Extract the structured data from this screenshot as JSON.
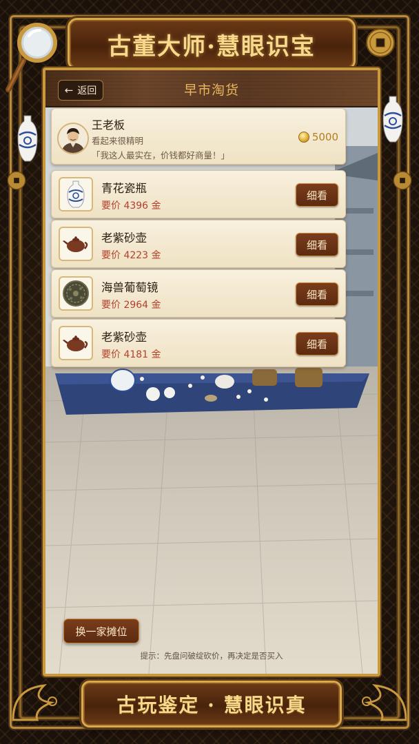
{
  "game": {
    "title": "古董大师·慧眼识宝",
    "footer_slogan": "古玩鉴定 · 慧眼识真"
  },
  "header": {
    "back_label": "返回",
    "back_icon": "left-arrow-icon",
    "title": "早市淘货"
  },
  "merchant": {
    "name": "王老板",
    "description": "看起来很精明",
    "quote": "「我这人最实在，价钱都好商量！」",
    "gold": "5000",
    "gold_icon": "gold-coin-icon"
  },
  "items": [
    {
      "name": "青花瓷瓶",
      "price": "要价 4396 金",
      "button": "细看",
      "icon": "blue-white-vase-icon"
    },
    {
      "name": "老紫砂壶",
      "price": "要价 4223 金",
      "button": "细看",
      "icon": "teapot-icon"
    },
    {
      "name": "海兽葡萄镜",
      "price": "要价 2964 金",
      "button": "细看",
      "icon": "bronze-mirror-icon"
    },
    {
      "name": "老紫砂壶",
      "price": "要价 4181 金",
      "button": "细看",
      "icon": "teapot-icon"
    }
  ],
  "footer": {
    "switch_label": "换一家摊位",
    "tip": "提示：先盘问破绽砍价，再决定是否买入"
  },
  "colors": {
    "accent_gold": "#d8a94f",
    "button_brown": "#6b3316",
    "price_red": "#b3402c",
    "header_title": "#e9b85e"
  }
}
